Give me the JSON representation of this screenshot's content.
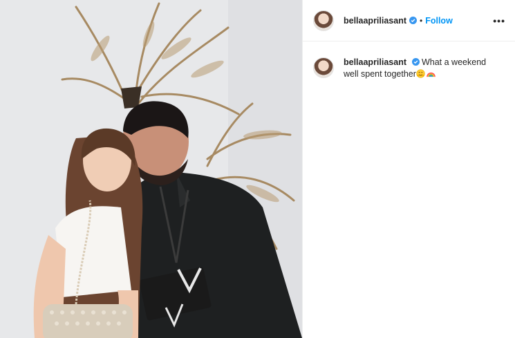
{
  "post": {
    "username": "bellaapriliasant",
    "follow_label": "Follow",
    "separator": "•",
    "more_label": "•••",
    "caption_text": "What a weekend well spent together",
    "caption_emojis": [
      "hugging-face-emoji",
      "rainbow-emoji"
    ]
  },
  "colors": {
    "follow": "#0095f6",
    "verified": "#3897f0",
    "text": "#262626",
    "divider": "#efefef"
  }
}
